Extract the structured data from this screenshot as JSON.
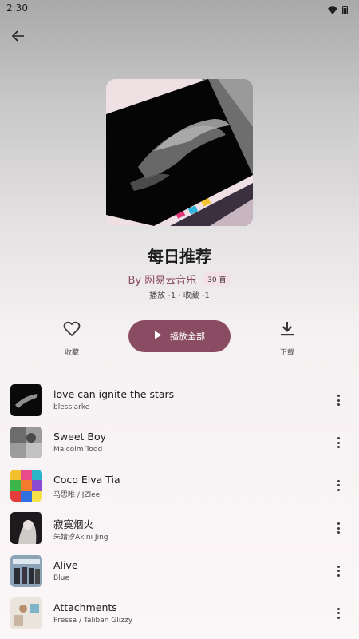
{
  "status": {
    "time": "2:30"
  },
  "playlist": {
    "title": "每日推荐",
    "by": "By 网易云音乐",
    "count": "30 首",
    "stats": "播放 -1 · 收藏 -1"
  },
  "actions": {
    "favorite_label": "收藏",
    "play_all_label": "播放全部",
    "download_label": "下载"
  },
  "songs": [
    {
      "title": "love can ignite the stars",
      "artist": "blesslarke"
    },
    {
      "title": "Sweet Boy",
      "artist": "Malcolm Todd"
    },
    {
      "title": "Coco Elva Tia",
      "artist": "马思唯 / JZlee"
    },
    {
      "title": "寂寞烟火",
      "artist": "朱婧汐Akini Jing"
    },
    {
      "title": "Alive",
      "artist": "Blue"
    },
    {
      "title": "Attachments",
      "artist": "Pressa / Taliban Glizzy"
    }
  ],
  "colors": {
    "accent": "#8a4c62",
    "badge_bg": "#f3e1e6"
  }
}
